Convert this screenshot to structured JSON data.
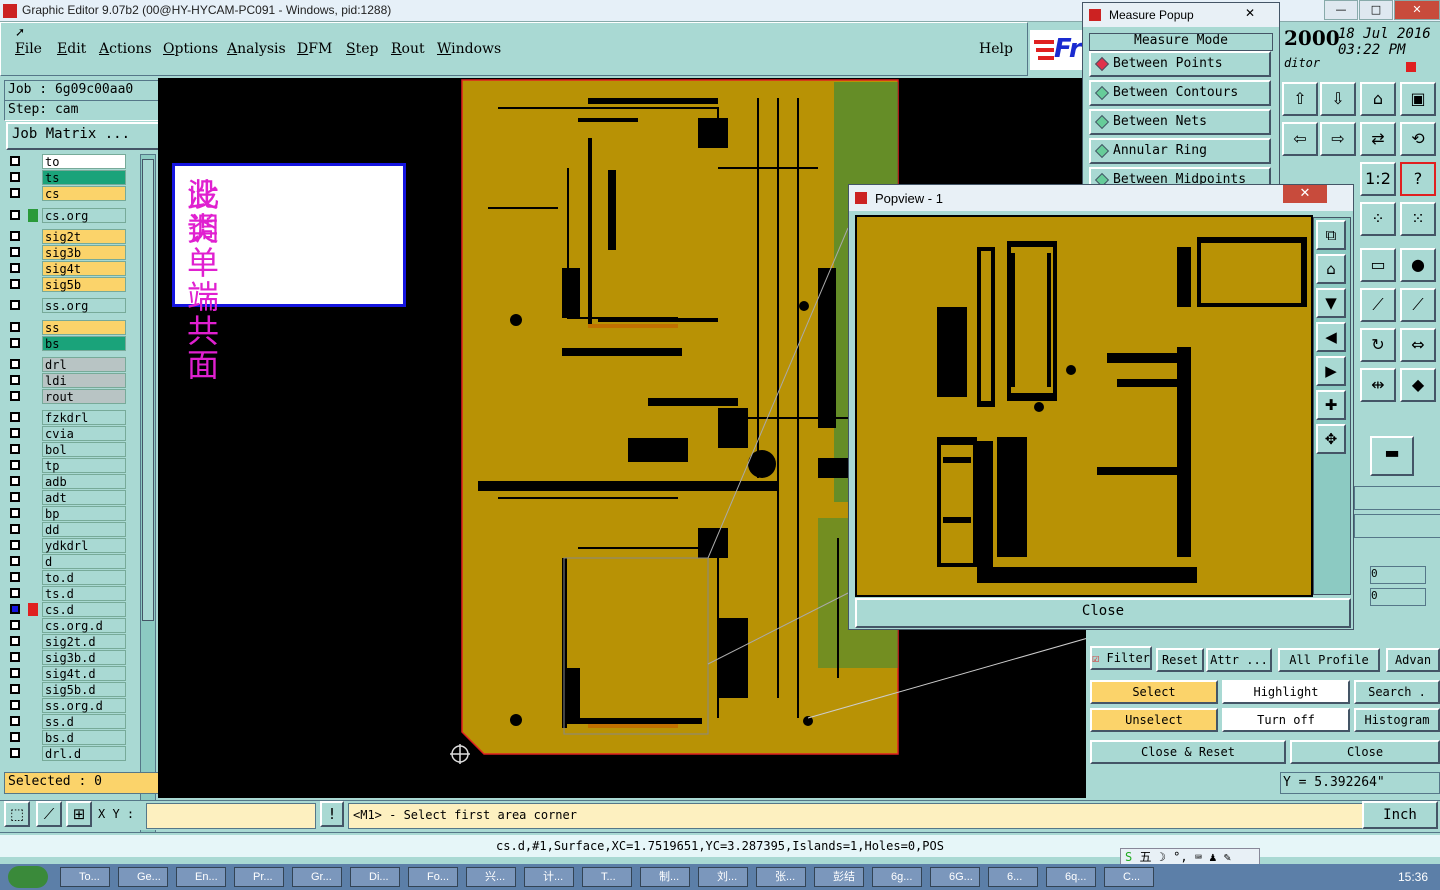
{
  "window": {
    "title": "Graphic Editor 9.07b2 (00@HY-HYCAM-PC091 - Windows, pid:1288)",
    "min": "—",
    "max": "□",
    "close": "✕"
  },
  "menu": [
    "File",
    "Edit",
    "Actions",
    "Options",
    "Analysis",
    "DFM",
    "Step",
    "Rout",
    "Windows"
  ],
  "help": "Help",
  "brand": "Fr",
  "job": {
    "job_label": "Job : 6g09c00aa0",
    "step_label": "Step: cam",
    "matrix_button": "Job Matrix ..."
  },
  "layers": [
    {
      "name": "to",
      "color": "#ffffff"
    },
    {
      "name": "ts",
      "color": "#1aa37a"
    },
    {
      "name": "cs",
      "color": "#fbd36a"
    },
    {
      "name": "cs.org",
      "color": "#a9d9d3"
    },
    {
      "name": "sig2t",
      "color": "#fbd36a"
    },
    {
      "name": "sig3b",
      "color": "#fbd36a"
    },
    {
      "name": "sig4t",
      "color": "#fbd36a"
    },
    {
      "name": "sig5b",
      "color": "#fbd36a"
    },
    {
      "name": "ss.org",
      "color": "#a9d9d3"
    },
    {
      "name": "ss",
      "color": "#fbd36a"
    },
    {
      "name": "bs",
      "color": "#1aa37a"
    },
    {
      "name": "drl",
      "color": "#b8c4c4"
    },
    {
      "name": "ldi",
      "color": "#b8c4c4"
    },
    {
      "name": "rout",
      "color": "#b8c4c4"
    },
    {
      "name": "fzkdrl",
      "color": "#a9d9d3"
    },
    {
      "name": "cvia",
      "color": "#a9d9d3"
    },
    {
      "name": "bol",
      "color": "#a9d9d3"
    },
    {
      "name": "tp",
      "color": "#a9d9d3"
    },
    {
      "name": "adb",
      "color": "#a9d9d3"
    },
    {
      "name": "adt",
      "color": "#a9d9d3"
    },
    {
      "name": "bp",
      "color": "#a9d9d3"
    },
    {
      "name": "dd",
      "color": "#a9d9d3"
    },
    {
      "name": "ydkdrl",
      "color": "#a9d9d3"
    },
    {
      "name": "d",
      "color": "#a9d9d3"
    },
    {
      "name": "to.d",
      "color": "#a9d9d3"
    },
    {
      "name": "ts.d",
      "color": "#a9d9d3"
    },
    {
      "name": "cs.d",
      "color": "#a9d9d3"
    },
    {
      "name": "cs.org.d",
      "color": "#a9d9d3"
    },
    {
      "name": "sig2t.d",
      "color": "#a9d9d3"
    },
    {
      "name": "sig3b.d",
      "color": "#a9d9d3"
    },
    {
      "name": "sig4t.d",
      "color": "#a9d9d3"
    },
    {
      "name": "sig5b.d",
      "color": "#a9d9d3"
    },
    {
      "name": "ss.org.d",
      "color": "#a9d9d3"
    },
    {
      "name": "ss.d",
      "color": "#a9d9d3"
    },
    {
      "name": "bs.d",
      "color": "#a9d9d3"
    },
    {
      "name": "drl.d",
      "color": "#a9d9d3"
    }
  ],
  "selected": "Selected : 0",
  "note": {
    "line1": "此类单端共面",
    "line2": "没调"
  },
  "measure": {
    "title": "Measure Popup",
    "header": "Measure Mode",
    "items": [
      "Between Points",
      "Between Contours",
      "Between Nets",
      "Annular Ring",
      "Between Midpoints"
    ],
    "active": "Between Points"
  },
  "popview": {
    "title": "Popview - 1",
    "close_label": "Close",
    "close_x": "✕"
  },
  "clock": {
    "year": "2000",
    "date": "18 Jul 2016",
    "time": "03:22 PM",
    "label": "ditor"
  },
  "filter": {
    "filter_label": "Filter",
    "reset": "Reset",
    "attr": "Attr ...",
    "profile": "All Profile",
    "advanced": "Advan",
    "select": "Select",
    "highlight": "Highlight",
    "search": "Search .",
    "unselect": "Unselect",
    "turn_off": "Turn off",
    "histogram": "Histogram",
    "close_reset": "Close & Reset",
    "close": "Close"
  },
  "coords": {
    "y": "Y = 5.392264\""
  },
  "bottom": {
    "xy_label": "X Y :",
    "xy_value": "",
    "prompt": "<M1> - Select first area corner",
    "units": "Inch",
    "status": "cs.d,#1,Surface,XC=1.7519651,YC=3.287395,Islands=1,Holes=0,POS"
  },
  "side_fields": [
    "0",
    "0"
  ],
  "taskbar": {
    "items": [
      "To...",
      "Ge...",
      "En...",
      "Pr...",
      "Gr...",
      "Di...",
      "Fo...",
      "兴...",
      "计...",
      "T...",
      "制...",
      "刘...",
      "张...",
      "彭结",
      "6g...",
      "6G...",
      "6...",
      "6q...",
      "C..."
    ],
    "time": "15:36"
  },
  "ime": "五"
}
